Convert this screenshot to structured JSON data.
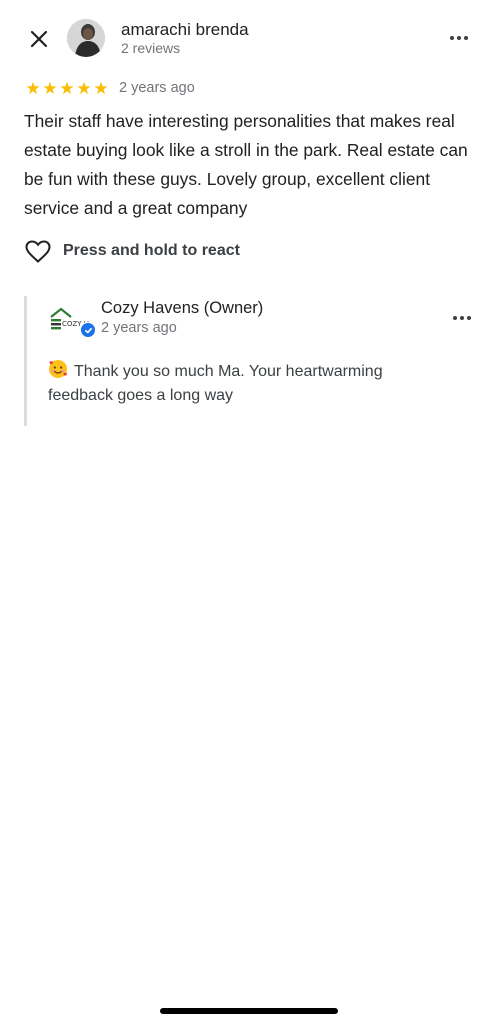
{
  "reviewer": {
    "name": "amarachi brenda",
    "meta": "2 reviews"
  },
  "review": {
    "rating": 5,
    "time": "2 years ago",
    "text": "Their staff have interesting personalities that makes real estate buying look like a stroll in the park. Real estate can be fun with these guys. Lovely group, excellent client service and a great company"
  },
  "react": {
    "label": "Press and hold to react"
  },
  "owner_reply": {
    "name": "Cozy Havens (Owner)",
    "time": "2 years ago",
    "text": "Thank you so much Ma. Your heartwarming feedback goes a long way",
    "logo_text": "COZY HOME"
  },
  "colors": {
    "star": "#fbbc04",
    "verified": "#1a73e8",
    "divider": "#dadce0"
  },
  "icons": [
    "close-icon",
    "more-icon",
    "star-icon",
    "heart-icon",
    "verified-icon",
    "smiling-hearts-emoji-icon"
  ]
}
